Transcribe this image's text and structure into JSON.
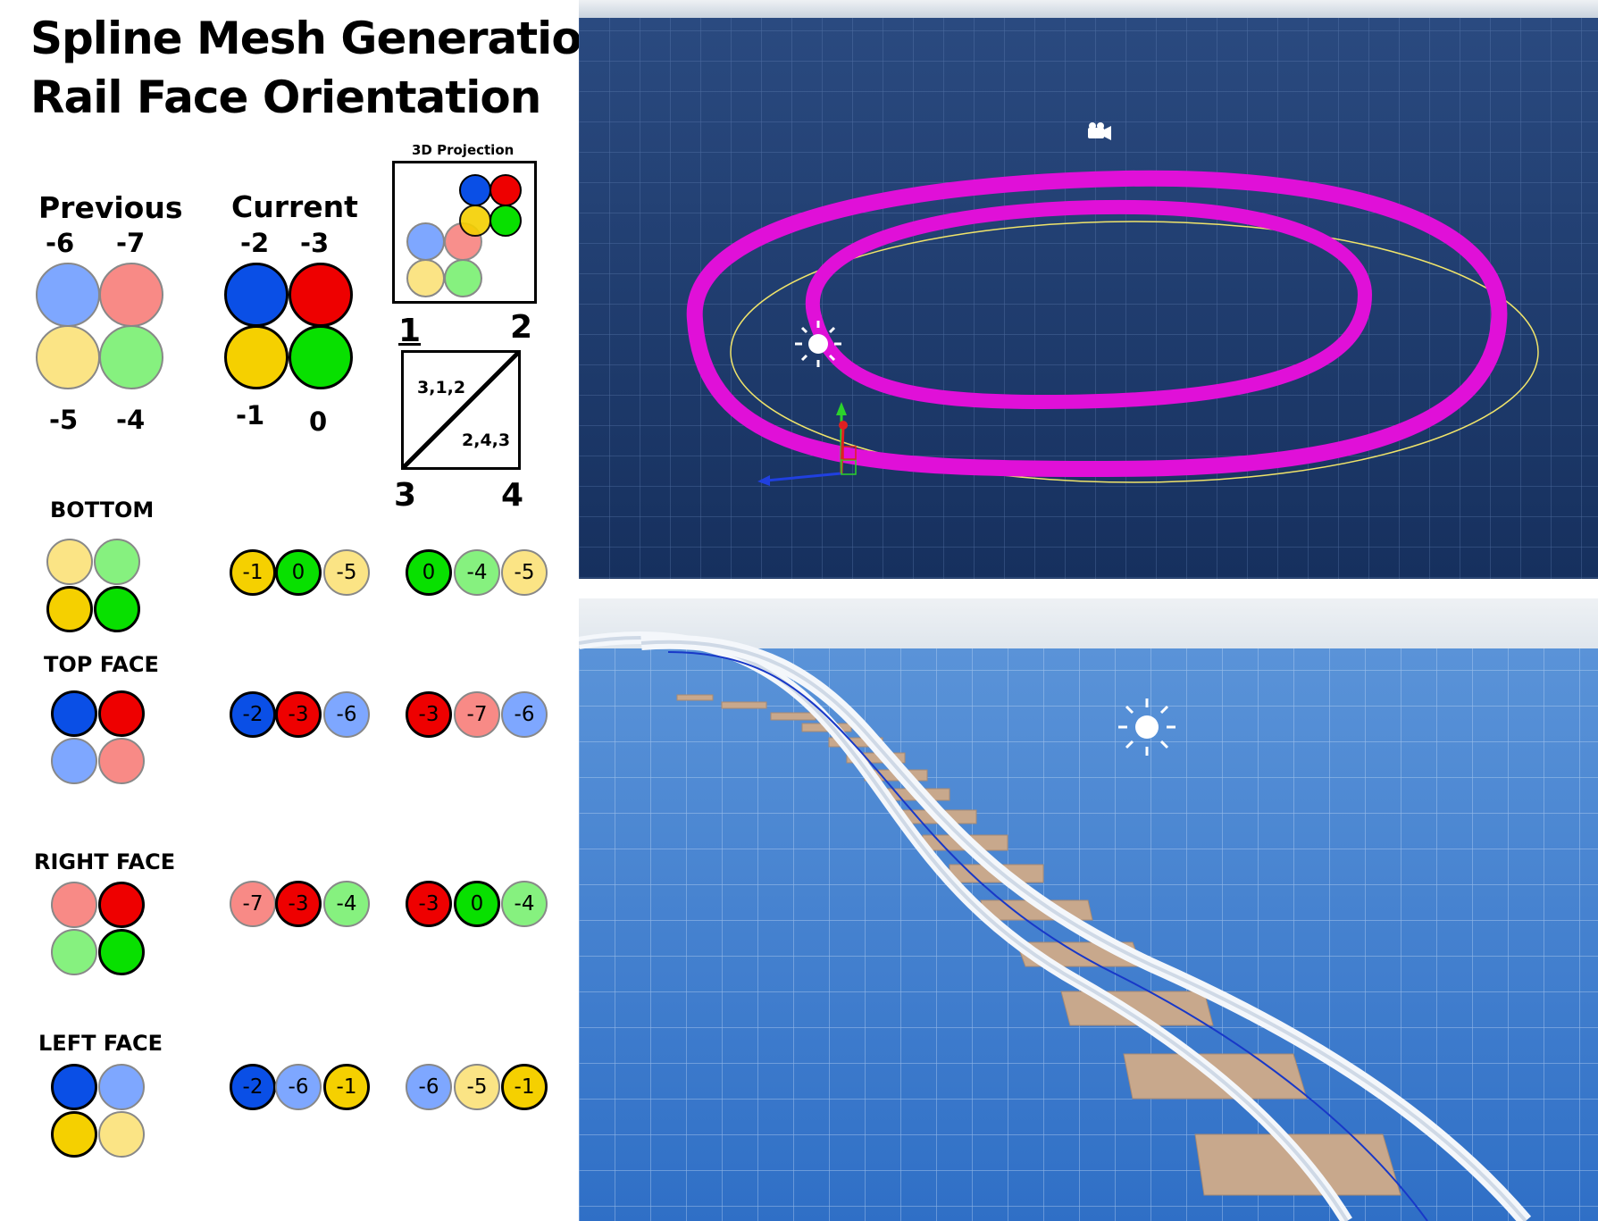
{
  "title": {
    "line1": "Spline Mesh Generation",
    "line2": "Rail Face Orientation"
  },
  "previous": {
    "label": "Previous",
    "top_left": "-6",
    "top_right": "-7",
    "bottom_left": "-5",
    "bottom_right": "-4"
  },
  "current": {
    "label": "Current",
    "top_left": "-2",
    "top_right": "-3",
    "bottom_left": "-1",
    "bottom_right": "0"
  },
  "projection": {
    "label": "3D Projection"
  },
  "triangle": {
    "corner_1": "1",
    "corner_2": "2",
    "corner_3": "3",
    "corner_4": "4",
    "upper_tri": "3,1,2",
    "lower_tri": "2,4,3"
  },
  "faces": [
    {
      "label": "BOTTOM",
      "tri_a": [
        "-1",
        "0",
        "-5"
      ],
      "tri_b": [
        "0",
        "-4",
        "-5"
      ]
    },
    {
      "label": "TOP FACE",
      "tri_a": [
        "-2",
        "-3",
        "-6"
      ],
      "tri_b": [
        "-3",
        "-7",
        "-6"
      ]
    },
    {
      "label": "RIGHT FACE",
      "tri_a": [
        "-7",
        "-3",
        "-4"
      ],
      "tri_b": [
        "-3",
        "0",
        "-4"
      ]
    },
    {
      "label": "LEFT FACE",
      "tri_a": [
        "-2",
        "-6",
        "-1"
      ],
      "tri_b": [
        "-6",
        "-5",
        "-1"
      ]
    }
  ],
  "colors": {
    "blue_dark": "#0a4fe6",
    "red_dark": "#ee0000",
    "yellow_dark": "#f5d000",
    "green_dark": "#08e000",
    "blue_light": "#7ea7ff",
    "red_light": "#f88a86",
    "yellow_light": "#fbe485",
    "green_light": "#86f17f",
    "spline_magenta": "#e010d8",
    "grid_dark": "#1d3d74",
    "grid_light": "#3a7fd8"
  },
  "views": {
    "top_view": "spline-loop-editor-viewport",
    "bottom_view": "rail-track-mesh-viewport"
  }
}
